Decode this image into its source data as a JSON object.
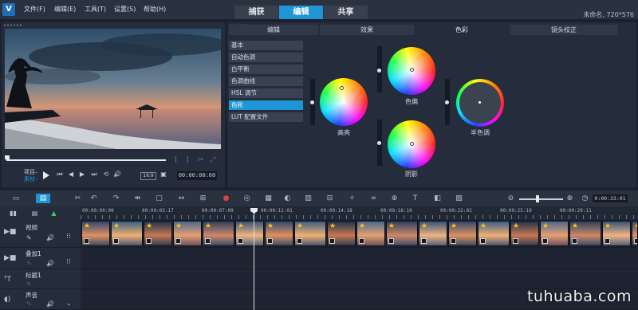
{
  "app": {
    "logo_text": "V",
    "project_info": "未命名, 720*576"
  },
  "menu": [
    "文件(F)",
    "编辑(E)",
    "工具(T)",
    "设置(S)",
    "帮助(H)"
  ],
  "workspace_tabs": [
    {
      "label": "捕获",
      "active": false
    },
    {
      "label": "编辑",
      "active": true
    },
    {
      "label": "共享",
      "active": false
    }
  ],
  "player": {
    "mode_labels": [
      "项目–",
      "素材–"
    ],
    "quality": "16:9",
    "timecode": "00:00:00:00"
  },
  "options": {
    "tabs": [
      {
        "label": "编辑",
        "active": false
      },
      {
        "label": "效果",
        "active": false
      },
      {
        "label": "色彩",
        "active": true
      },
      {
        "label": "镜头校正",
        "active": false
      }
    ],
    "categories": [
      {
        "label": "基本",
        "active": false
      },
      {
        "label": "自动色调",
        "active": false
      },
      {
        "label": "白平衡",
        "active": false
      },
      {
        "label": "色调曲线",
        "active": false
      },
      {
        "label": "HSL 调节",
        "active": false
      },
      {
        "label": "色轮",
        "active": true
      },
      {
        "label": "LUT 配置文件",
        "active": false
      }
    ],
    "wheels": {
      "highlight": "高亮",
      "shadow_top": "色偏",
      "shadow": "阴影",
      "midtone": "半色调"
    }
  },
  "timeline": {
    "timecode": "0:00:33:01",
    "ruler": [
      "00:00:00:00",
      "00:00:03:17",
      "00:00:07:09",
      "00:00:11:01",
      "00:00:14:18",
      "00:00:18:10",
      "00:00:22:02",
      "00:00:25:19",
      "00:00:29:11"
    ],
    "tracks": [
      {
        "name": "视频"
      },
      {
        "name": "叠加1"
      },
      {
        "name": "标题1"
      },
      {
        "name": "声音"
      }
    ]
  },
  "watermark": "tuhuaba.com",
  "colors": {
    "accent": "#1e96d6",
    "panel": "#252c3b",
    "background": "#1b2130"
  }
}
